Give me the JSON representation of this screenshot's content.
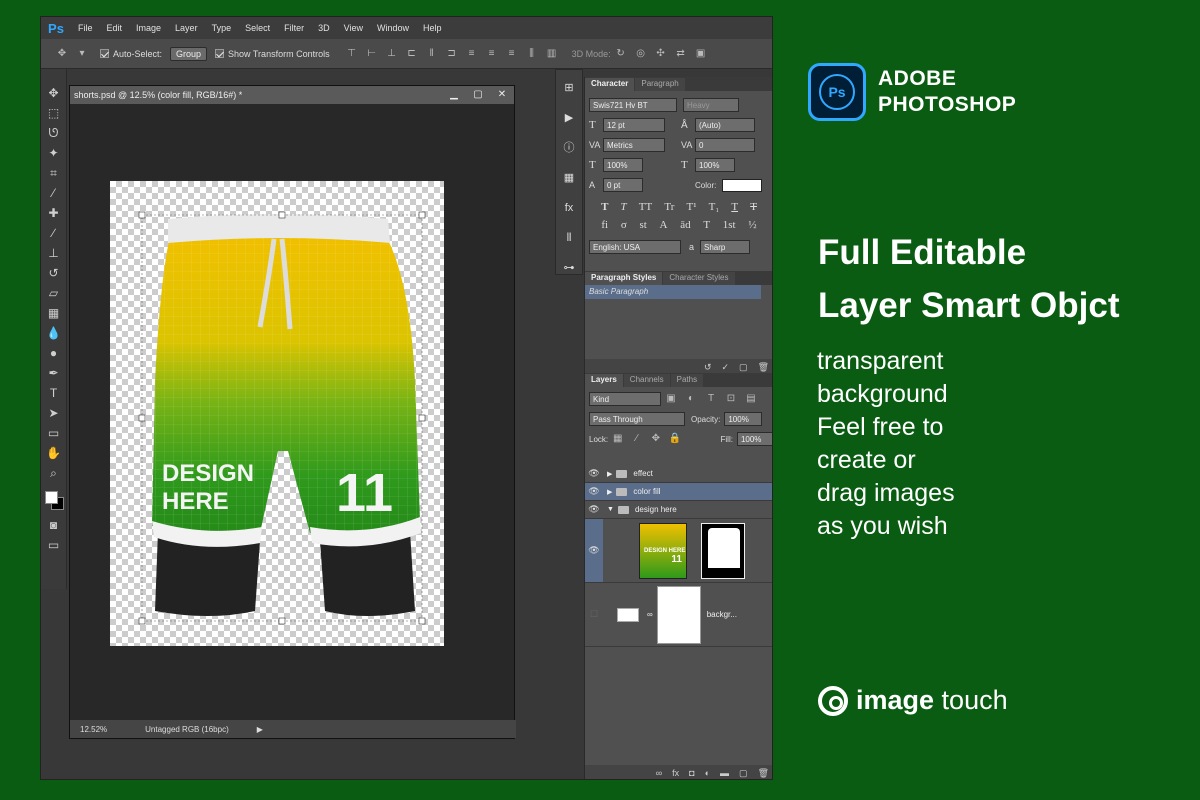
{
  "photoshop": {
    "logo": "Ps",
    "menu": [
      "File",
      "Edit",
      "Image",
      "Layer",
      "Type",
      "Select",
      "Filter",
      "3D",
      "View",
      "Window",
      "Help"
    ],
    "options": {
      "auto_select_label": "Auto-Select:",
      "auto_select_value": "Group",
      "show_transform_label": "Show Transform Controls",
      "mode_3d_label": "3D Mode:"
    },
    "document": {
      "title": "shorts.psd @ 12.5% (color fill, RGB/16#) *",
      "zoom": "12.52%",
      "profile": "Untagged RGB (16bpc)"
    },
    "character_panel": {
      "tabs": [
        "Character",
        "Paragraph"
      ],
      "font_family": "Swis721 Hv BT",
      "font_style": "Heavy",
      "font_size": "12 pt",
      "leading": "(Auto)",
      "kerning": "Metrics",
      "tracking": "0",
      "vertical_scale": "100%",
      "horizontal_scale": "100%",
      "baseline_shift": "0 pt",
      "color_label": "Color:",
      "style_glyphs": [
        "T",
        "T",
        "TT",
        "Tr",
        "T¹",
        "T₁",
        "T",
        "T"
      ],
      "opentype_glyphs": [
        "fi",
        "σ",
        "st",
        "A",
        "ād",
        "T",
        "1st",
        "½"
      ],
      "language": "English: USA",
      "aa_label": "a",
      "aa_method": "Sharp"
    },
    "paragraph_styles_panel": {
      "tabs": [
        "Paragraph Styles",
        "Character Styles"
      ],
      "selected_style": "Basic Paragraph"
    },
    "layers_panel": {
      "tabs": [
        "Layers",
        "Channels",
        "Paths"
      ],
      "filter_kind": "Kind",
      "blend_mode": "Pass Through",
      "opacity_label": "Opacity:",
      "opacity": "100%",
      "lock_label": "Lock:",
      "fill_label": "Fill:",
      "fill": "100%",
      "layers": [
        {
          "name": "effect"
        },
        {
          "name": "color fill"
        },
        {
          "name": "design here"
        },
        {
          "name": "backgr..."
        }
      ],
      "thumb_design": "DESIGN HERE",
      "thumb_number": "11"
    }
  },
  "mockup": {
    "design_text_1": "DESIGN",
    "design_text_2": "HERE",
    "number": "11"
  },
  "promo": {
    "brand_logo": "Ps",
    "brand_line1": "ADOBE",
    "brand_line2": "PHOTOSHOP",
    "headline_line1": "Full Editable",
    "headline_line2": "Layer Smart Objct",
    "body_lines": [
      "transparent",
      "background",
      "Feel free to",
      "create or",
      "drag images",
      "as you wish"
    ],
    "footer_brand_bold": "image",
    "footer_brand_light": " touch"
  },
  "colors": {
    "background_green": "#0a5c12",
    "shorts_yellow": "#e8b800",
    "shorts_green": "#2e9a1a",
    "ps_blue": "#31a8ff",
    "selected_layer": "#5a6e8c"
  }
}
